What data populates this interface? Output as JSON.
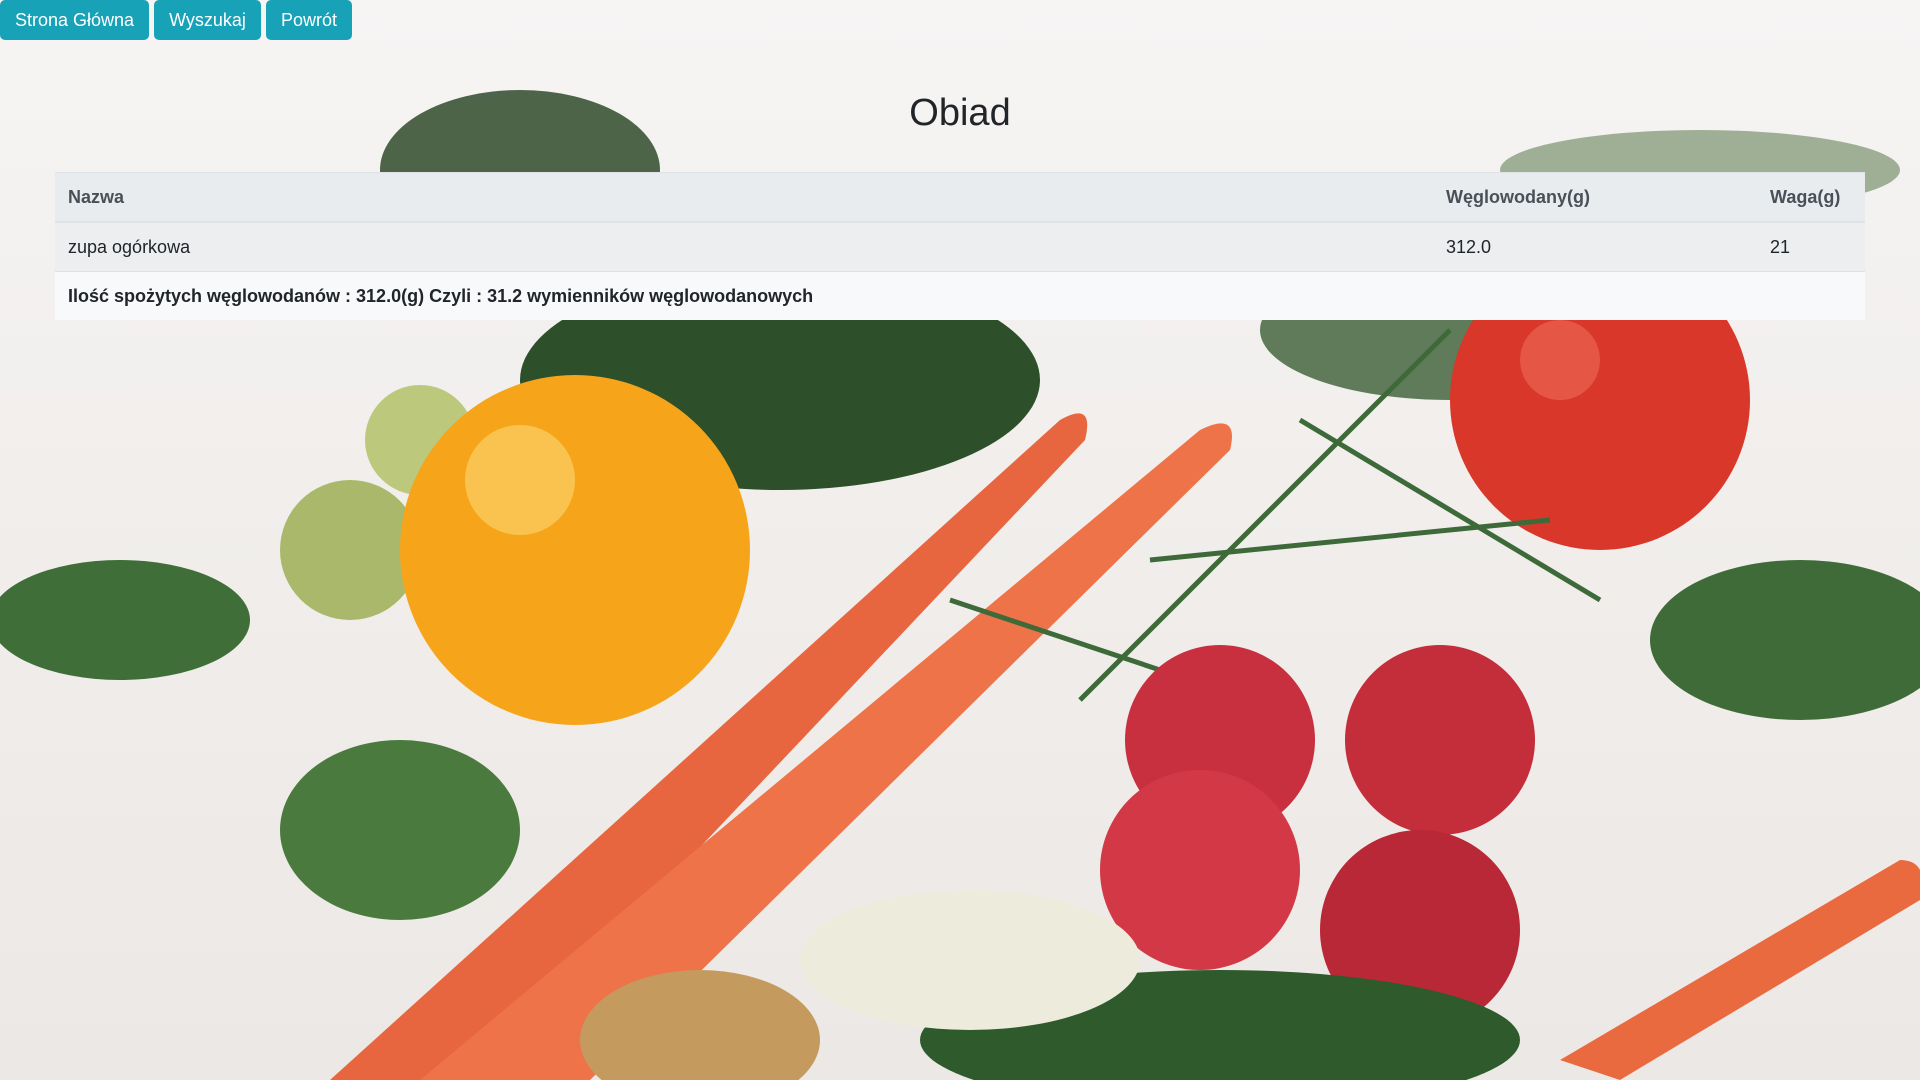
{
  "nav": {
    "home_label": "Strona Główna",
    "search_label": "Wyszukaj",
    "back_label": "Powrót"
  },
  "page": {
    "title": "Obiad"
  },
  "table": {
    "headers": {
      "name": "Nazwa",
      "carbs": "Węglowodany(g)",
      "weight": "Waga(g)"
    },
    "rows": [
      {
        "name": "zupa ogórkowa",
        "carbs": "312.0",
        "weight": "21"
      }
    ],
    "summary": "Ilość spożytych węglowodanów : 312.0(g) Czyli : 31.2 wymienników węglowodanowych"
  },
  "colors": {
    "button": "#17a2b8",
    "header_bg": "#e9ecef",
    "summary_bg": "#f8f9fa"
  }
}
